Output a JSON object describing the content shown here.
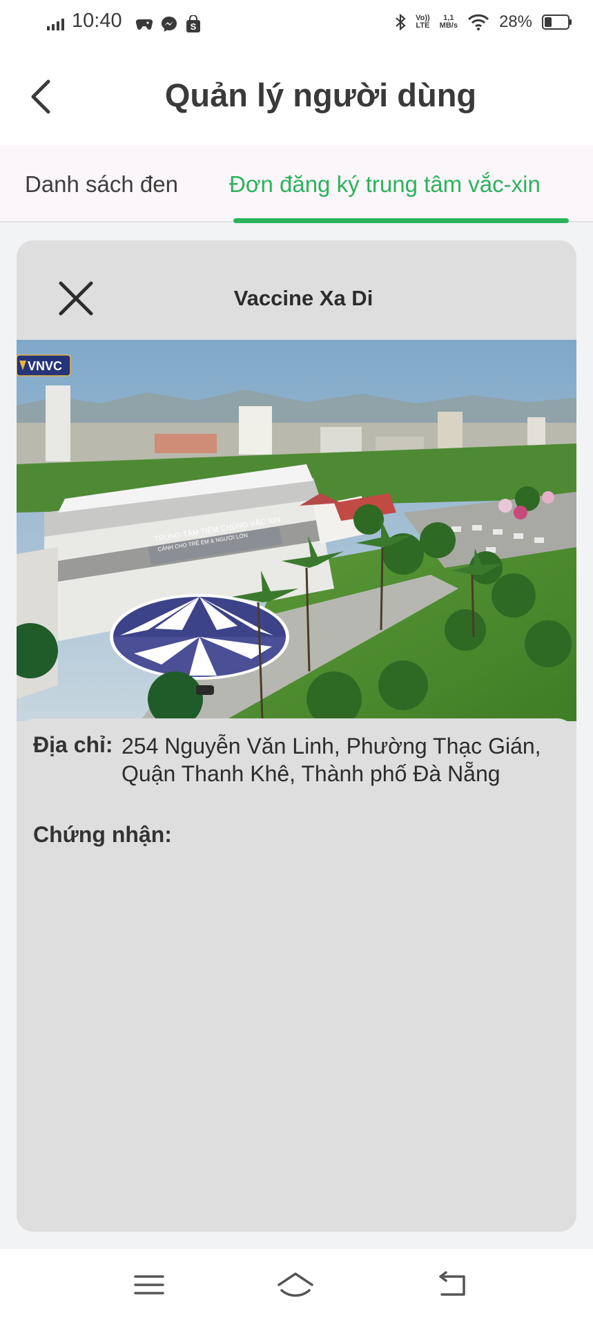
{
  "status_bar": {
    "time": "10:40",
    "net_speed_value": "1,1",
    "net_speed_unit": "MB/s",
    "volte_top": "Vo))",
    "volte_bottom": "LTE",
    "battery": "28%",
    "icons": [
      "signal-icon",
      "game-controller-icon",
      "messenger-icon",
      "shopping-bag-icon",
      "bluetooth-icon",
      "volte-icon",
      "wifi-icon",
      "battery-icon"
    ]
  },
  "header": {
    "title": "Quản lý người dùng",
    "back_icon": "chevron-left-icon"
  },
  "tabs": [
    {
      "label": "Danh sách đen",
      "active": false
    },
    {
      "label": "Đơn đăng ký trung tâm vắc-xin",
      "active": true
    }
  ],
  "card": {
    "title": "Vaccine Xa Di",
    "close_icon": "close-icon",
    "photo": {
      "logo_text": "VNVC",
      "sign_line1": "TRUNG TÂM TIÊM CHỦNG VẮC XIN",
      "sign_line2": "CẢNH CHO TRẺ EM & NGƯỜI LỚN"
    },
    "address_label": "Địa chỉ:",
    "address_value": "254 Nguyễn Văn Linh, Phường Thạc Gián, Quận Thanh Khê, Thành phố Đà Nẵng",
    "certificate_label": "Chứng nhận:"
  },
  "nav": {
    "icons": [
      "menu-icon",
      "home-icon",
      "back-icon"
    ]
  },
  "colors": {
    "accent": "#2bb35a",
    "card_bg": "#dedede",
    "page_bg": "#f2f3f5",
    "tab_bg": "#fbf6fa"
  }
}
